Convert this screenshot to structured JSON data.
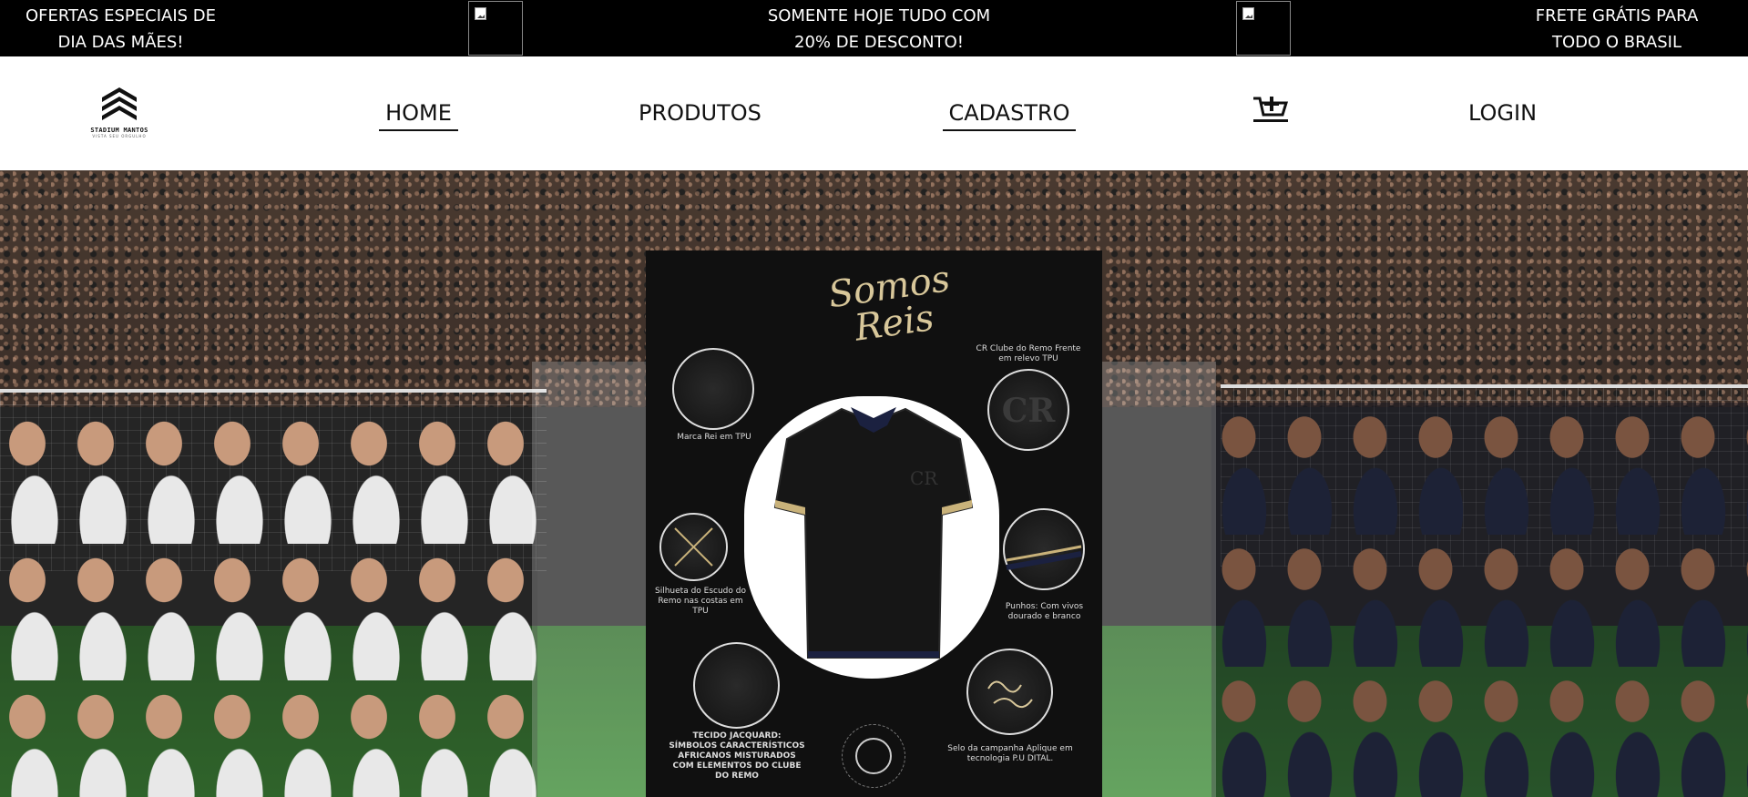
{
  "promo": {
    "left_line1": "OFERTAS ESPECIAIS DE",
    "left_line2": "DIA DAS MÃES!",
    "center_line1": "SOMENTE HOJE TUDO COM",
    "center_line2": "20% DE DESCONTO!",
    "right_line1": "FRETE GRÁTIS PARA",
    "right_line2": "TODO O BRASIL"
  },
  "nav": {
    "home": "HOME",
    "produtos": "PRODUTOS",
    "cadastro": "CADASTRO",
    "login": "LOGIN",
    "active": "HOME"
  },
  "logo": {
    "name": "STADIUM MANTOS",
    "tagline": "VISTA SEU ORGULHO"
  },
  "poster": {
    "title_line1": "Somos",
    "title_line2": "Reis",
    "captions": [
      "Marca Rei em TPU",
      "Silhueta do Escudo do Remo nas costas em TPU",
      "TECIDO JACQUARD: SÍMBOLOS CARACTERÍSTICOS AFRICANOS MISTURADOS COM ELEMENTOS DO CLUBE DO REMO",
      "CR Clube do Remo Frente em relevo TPU",
      "Punhos: Com vivos dourado e branco",
      "Selo da campanha Aplique em tecnologia P.U DITAL."
    ]
  },
  "icons": {
    "cart": "cart-icon",
    "logo": "chevrons-logo-icon",
    "broken_image": "broken-image-icon"
  },
  "colors": {
    "promo_bg": "#000000",
    "gold": "#d8c79a"
  }
}
